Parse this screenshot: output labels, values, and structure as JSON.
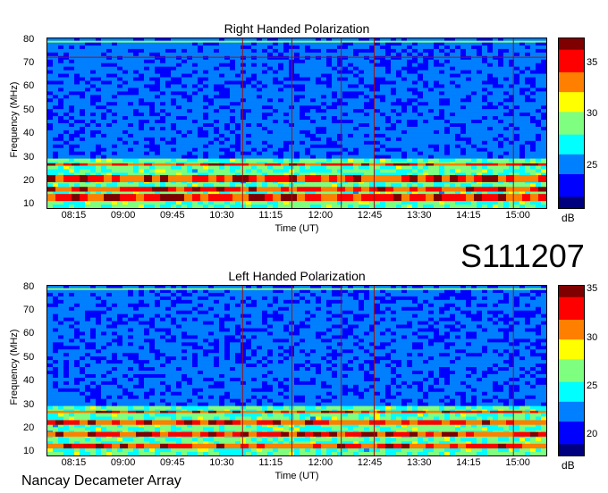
{
  "session_code": "S111207",
  "observatory": "Nancay Decameter Array",
  "colorbar_unit": "dB",
  "colormap": [
    "#00007f",
    "#0000ff",
    "#007fff",
    "#00ffff",
    "#7fff7f",
    "#ffff00",
    "#ff7f00",
    "#ff0000",
    "#7f0000"
  ],
  "chart_data": [
    {
      "type": "heatmap",
      "title": "Right Handed Polarization",
      "xlabel": "Time (UT)",
      "ylabel": "Frequency (MHz)",
      "x_ticks": [
        "08:15",
        "09:00",
        "09:45",
        "10:30",
        "11:15",
        "12:00",
        "12:45",
        "13:30",
        "14:15",
        "15:00"
      ],
      "y_ticks": [
        10,
        20,
        30,
        40,
        50,
        60,
        70,
        80
      ],
      "ylim": [
        9,
        81
      ],
      "colorbar_ticks": [
        25,
        30,
        35
      ],
      "colorbar_range": [
        21,
        37.5
      ],
      "strong_bands_MHz": [
        [
          12,
          15
        ],
        [
          16,
          18
        ],
        [
          20,
          23
        ],
        [
          27,
          28
        ]
      ],
      "vertical_markers_UT": [
        "10:48",
        "11:33",
        "12:18",
        "12:48",
        "14:55"
      ],
      "horizontal_marker_MHz": 73
    },
    {
      "type": "heatmap",
      "title": "Left Handed Polarization",
      "xlabel": "Time (UT)",
      "ylabel": "Frequency (MHz)",
      "x_ticks": [
        "08:15",
        "09:00",
        "09:45",
        "10:30",
        "11:15",
        "12:00",
        "12:45",
        "13:30",
        "14:15",
        "15:00"
      ],
      "y_ticks": [
        10,
        20,
        30,
        40,
        50,
        60,
        70,
        80
      ],
      "ylim": [
        9,
        81
      ],
      "colorbar_ticks": [
        20,
        25,
        30,
        35
      ],
      "colorbar_range": [
        18,
        35.5
      ],
      "strong_bands_MHz": [
        [
          12,
          14
        ],
        [
          17,
          19
        ],
        [
          22,
          24
        ],
        [
          27,
          28
        ]
      ],
      "vertical_markers_UT": [
        "10:48",
        "11:33",
        "12:18",
        "12:48",
        "14:55"
      ],
      "horizontal_marker_MHz": null
    }
  ]
}
